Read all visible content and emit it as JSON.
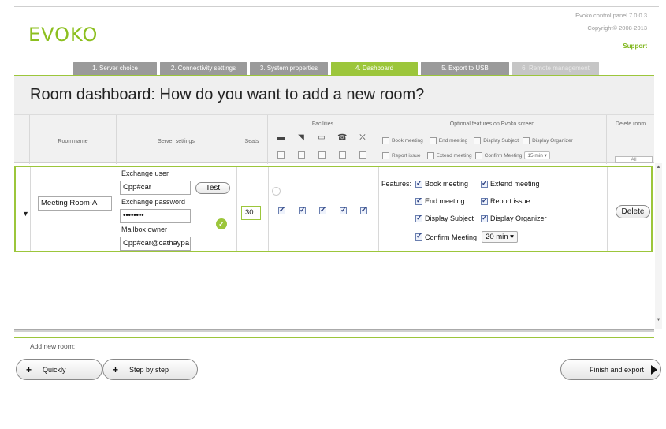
{
  "header": {
    "logo": "EVOKO",
    "version": "Evoko control panel 7.0.0.3",
    "copyright": "Copyright© 2008-2013",
    "support": "Support"
  },
  "tabs": [
    {
      "label": "1. Server choice",
      "state": "normal"
    },
    {
      "label": "2. Connectivity settings",
      "state": "normal"
    },
    {
      "label": "3. System properties",
      "state": "normal"
    },
    {
      "label": "4. Dashboard",
      "state": "active"
    },
    {
      "label": "5. Export to USB",
      "state": "normal"
    },
    {
      "label": "6. Remote management",
      "state": "disabled"
    }
  ],
  "page": {
    "title": "Room dashboard: How do you want to add a new room?"
  },
  "table": {
    "headers": {
      "room_name": "Room name",
      "server_settings": "Server settings",
      "seats": "Seats",
      "facilities": "Facilities",
      "optional_features": "Optional features on Evoko screen",
      "delete_room": "Delete room"
    },
    "facility_icons": [
      "projector-icon",
      "whiteboard-icon",
      "monitor-icon",
      "phone-icon",
      "videoconference-icon"
    ],
    "optional_filters": {
      "book_meeting": "Book meeting",
      "end_meeting": "End meeting",
      "display_subject": "Display Subject",
      "display_organizer": "Display Organizer",
      "report_issue": "Report issue",
      "extend_meeting": "Extend meeting",
      "confirm_meeting": "Confirm Meeting",
      "confirm_value": "15 min"
    },
    "all_button": "All"
  },
  "room": {
    "name": "Meeting Room-A",
    "exchange_user_label": "Exchange user",
    "exchange_user": "Cpp#car",
    "test_button": "Test",
    "exchange_password_label": "Exchange password",
    "exchange_password": "••••••••",
    "mailbox_owner_label": "Mailbox owner",
    "mailbox_owner": "Cpp#car@cathaypa",
    "seats": "30",
    "features_label": "Features:",
    "features": {
      "book_meeting": "Book meeting",
      "extend_meeting": "Extend meeting",
      "end_meeting": "End meeting",
      "report_issue": "Report issue",
      "display_subject": "Display Subject",
      "display_organizer": "Display Organizer",
      "confirm_meeting": "Confirm Meeting",
      "confirm_value": "20 min"
    },
    "delete_button": "Delete"
  },
  "footer": {
    "add_new_room": "Add new room:",
    "quickly": "Quickly",
    "step_by_step": "Step by step",
    "finish_and_export": "Finish and export"
  },
  "colors": {
    "accent": "#9cc63b",
    "tab_gray": "#9a9a9a"
  }
}
